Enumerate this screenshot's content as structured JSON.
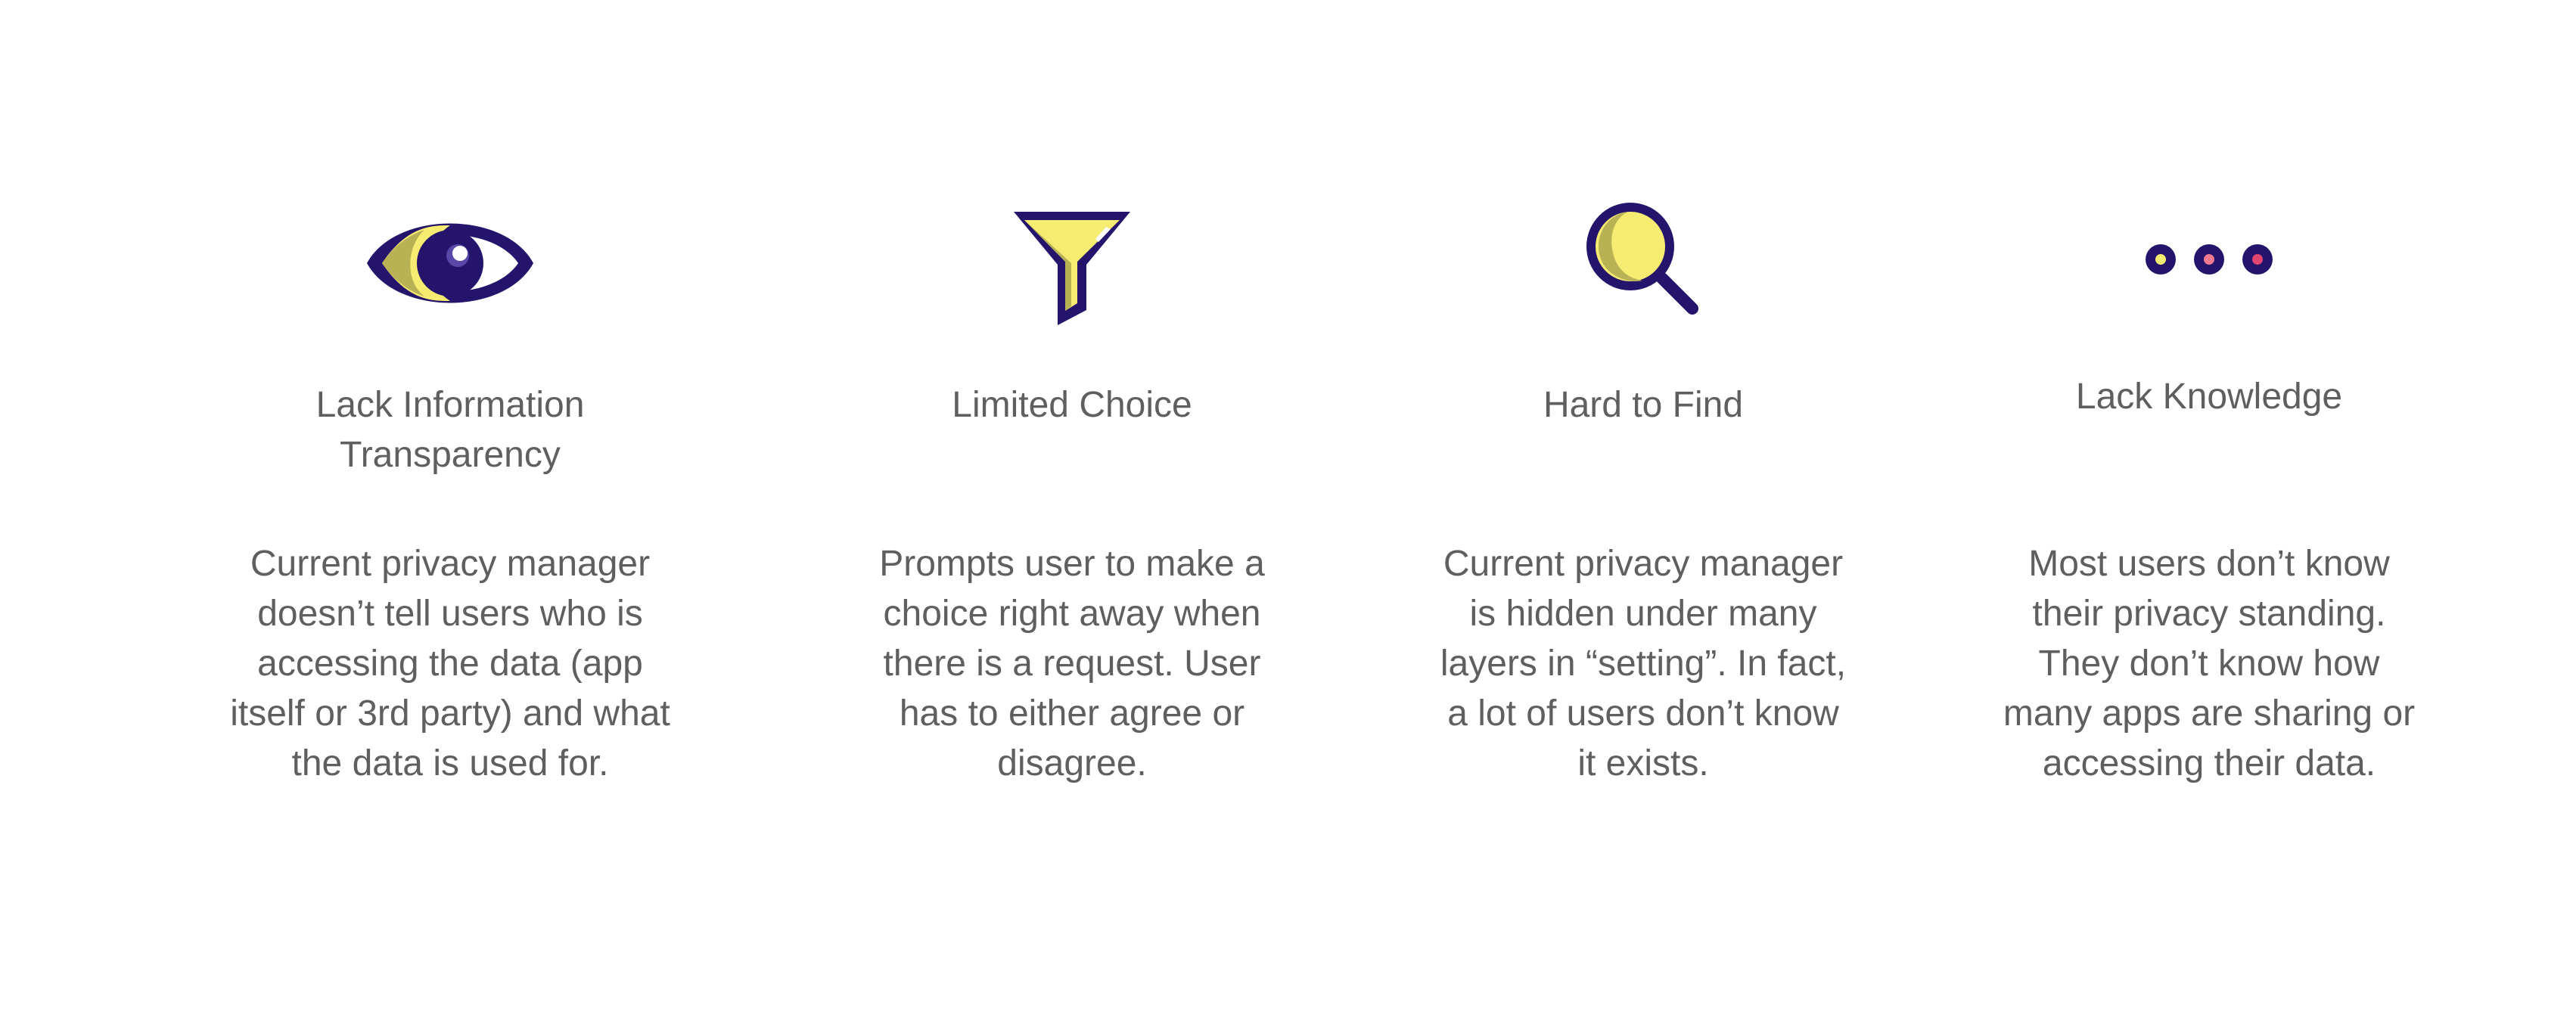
{
  "colors": {
    "navy": "#24146b",
    "yellow": "#f7ec72",
    "olive": "#b9b255",
    "text": "#5f5f5f",
    "purple_highlight": "#5a48a8",
    "pink_dot": "#f07a8f",
    "red_dot": "#e2456f"
  },
  "cards": [
    {
      "icon": "eye-icon",
      "title": "Lack Information\nTransparency",
      "description": "Current privacy manager\ndoesn’t tell users who is\naccessing the data (app\nitself or 3rd party) and what\nthe data is used for."
    },
    {
      "icon": "funnel-icon",
      "title": "Limited Choice",
      "description": "Prompts user to make a\nchoice right away when\nthere is a request. User\nhas to either agree or\ndisagree."
    },
    {
      "icon": "magnifier-icon",
      "title": "Hard to Find",
      "description": "Current privacy manager\nis hidden under many\nlayers in “setting”. In fact,\na lot of users don’t know\nit exists."
    },
    {
      "icon": "more-dots-icon",
      "title": "Lack Knowledge",
      "description": "Most users don’t know\ntheir privacy standing.\nThey don’t know how\nmany apps are sharing or\naccessing their data."
    }
  ]
}
